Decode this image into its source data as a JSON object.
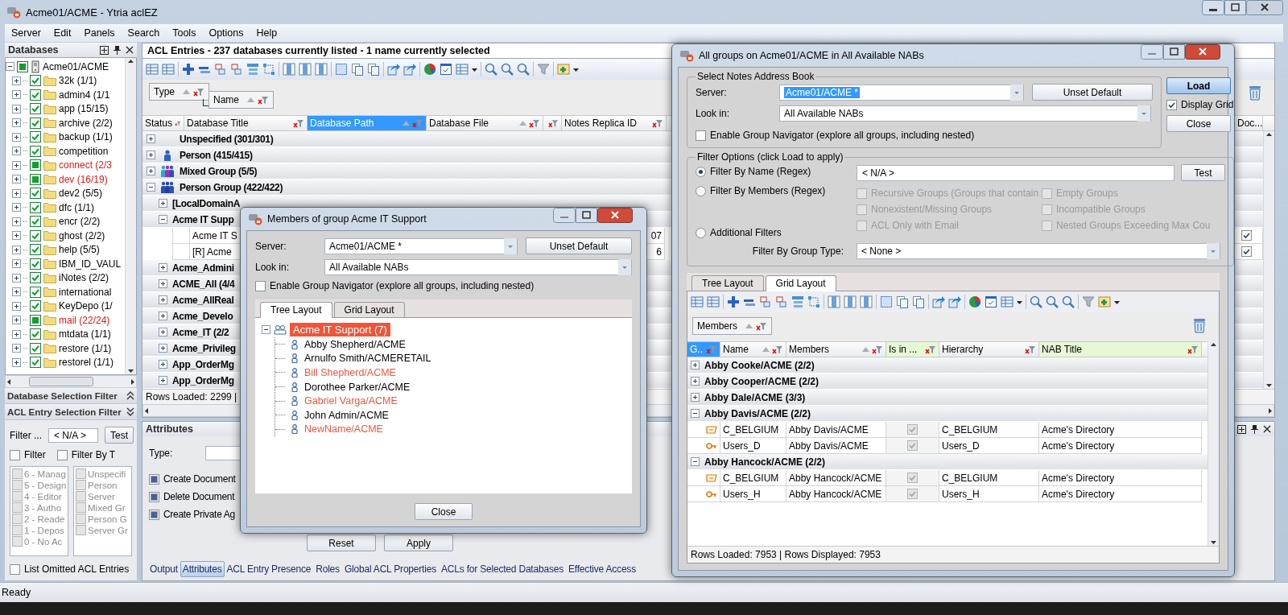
{
  "window": {
    "title": "Acme01/ACME - Ytria aclEZ"
  },
  "menu": [
    "Server",
    "Edit",
    "Panels",
    "Search",
    "Tools",
    "Options",
    "Help"
  ],
  "databases": {
    "title": "Databases",
    "root": {
      "label": "Acme01/ACME",
      "checked": true,
      "partial": true,
      "expanded": true,
      "children": [
        {
          "label": "32k  (1/1)",
          "checked": true,
          "partial": false
        },
        {
          "label": "admin4  (1/1",
          "checked": true,
          "partial": false
        },
        {
          "label": "app  (15/15)",
          "checked": true,
          "partial": false
        },
        {
          "label": "archive  (2/2)",
          "checked": true,
          "partial": false
        },
        {
          "label": "backup  (1/1)",
          "checked": true,
          "partial": false
        },
        {
          "label": "competition",
          "checked": true,
          "partial": false
        },
        {
          "label": "connect  (2/3",
          "checked": true,
          "partial": true
        },
        {
          "label": "dev  (16/19)",
          "checked": true,
          "partial": true
        },
        {
          "label": "dev2  (5/5)",
          "checked": true,
          "partial": false
        },
        {
          "label": "dfc  (1/1)",
          "checked": true,
          "partial": false
        },
        {
          "label": "encr  (2/2)",
          "checked": true,
          "partial": false
        },
        {
          "label": "ghost  (2/2)",
          "checked": true,
          "partial": false
        },
        {
          "label": "help  (5/5)",
          "checked": true,
          "partial": false
        },
        {
          "label": "IBM_ID_VAUL",
          "checked": true,
          "partial": false
        },
        {
          "label": "iNotes  (2/2)",
          "checked": true,
          "partial": false
        },
        {
          "label": "international",
          "checked": true,
          "partial": false
        },
        {
          "label": "KeyDepo  (1/",
          "checked": true,
          "partial": false
        },
        {
          "label": "mail  (22/24)",
          "checked": true,
          "partial": true
        },
        {
          "label": "mtdata  (1/1)",
          "checked": true,
          "partial": false
        },
        {
          "label": "restore  (1/1)",
          "checked": true,
          "partial": false
        },
        {
          "label": "restorel  (1/1)",
          "checked": true,
          "partial": false
        }
      ]
    }
  },
  "database_selection_filter": {
    "title": "Database Selection Filter",
    "expanded": false
  },
  "acl_entry_filter": {
    "title": "ACL Entry Selection Filter",
    "expanded": true,
    "filter_label": "Filter ...",
    "filter_value": "< N/A >",
    "test_button": "Test",
    "options": [
      {
        "label": "Filter",
        "checked": false
      },
      {
        "label": "Filter By T",
        "checked": false
      }
    ],
    "levels": [
      {
        "label": "6 - Manag",
        "checked": false
      },
      {
        "label": "5 - Design",
        "checked": false
      },
      {
        "label": "4 - Editor",
        "checked": false
      },
      {
        "label": "3 - Autho",
        "checked": false
      },
      {
        "label": "2 - Reade",
        "checked": false
      },
      {
        "label": "1 - Depos",
        "checked": false
      },
      {
        "label": "0 - No Ac",
        "checked": false
      }
    ],
    "types": [
      {
        "label": "Unspecifi",
        "checked": false
      },
      {
        "label": "Person",
        "checked": false
      },
      {
        "label": "Server",
        "checked": false
      },
      {
        "label": "Mixed Gr",
        "checked": false
      },
      {
        "label": "Person G",
        "checked": false
      },
      {
        "label": "Server Gr",
        "checked": false
      }
    ],
    "list_omitted": {
      "label": "List Omitted ACL Entries",
      "checked": false
    }
  },
  "acl_entries": {
    "title": "ACL Entries - 237 databases currently listed - 1 name currently selected",
    "group_by": [
      "Type",
      "Name"
    ],
    "columns": [
      {
        "label": "Status",
        "selected": false,
        "sorted": false
      },
      {
        "label": "Database Title",
        "selected": false,
        "sorted": false
      },
      {
        "label": "Database Path",
        "selected": true,
        "sorted": true
      },
      {
        "label": "Database File",
        "selected": false,
        "sorted": true
      },
      {
        "selected": false,
        "sorted": false
      },
      {
        "label": "Notes Replica ID",
        "selected": false,
        "sorted": false
      }
    ],
    "last_column": "Doc...",
    "rows": [
      {
        "kind": "unspecified",
        "label": "Unspecified (301/301)",
        "expanded": false
      },
      {
        "kind": "person",
        "label": "Person (415/415)",
        "expanded": false
      },
      {
        "kind": "mixed",
        "label": "Mixed Group (5/5)",
        "expanded": false
      },
      {
        "kind": "group",
        "label": "Person Group (422/422)",
        "expanded": true,
        "children": [
          {
            "label": "[LocalDomainA",
            "expanded": false
          },
          {
            "label": "Acme IT Supp",
            "expanded": true,
            "entries": [
              {
                "title": "Acme IT S",
                "value": "07",
                "doc_checked": true
              },
              {
                "title": "[R] Acme",
                "value": "6",
                "doc_checked": true
              }
            ]
          },
          {
            "label": "Acme_Admini",
            "expanded": false
          },
          {
            "label": "ACME_All (4/4",
            "expanded": false
          },
          {
            "label": "Acme_AllReal",
            "expanded": false
          },
          {
            "label": "Acme_Develo",
            "expanded": false
          },
          {
            "label": "Acme_IT (2/2",
            "expanded": false
          },
          {
            "label": "Acme_Privileg",
            "expanded": false
          },
          {
            "label": "App_OrderMg",
            "expanded": false
          },
          {
            "label": "App_OrderMg",
            "expanded": false
          }
        ]
      }
    ],
    "status": "Rows Loaded: 2299  |"
  },
  "attributes": {
    "title": "Attributes",
    "type_label": "Type:",
    "permissions": [
      {
        "label": "Create Document",
        "checked": true
      },
      {
        "label": "Delete Document",
        "checked": true
      },
      {
        "label": "Create Private Ag",
        "checked": true
      }
    ],
    "buttons": [
      "Reset",
      "Apply"
    ]
  },
  "bottom_tabs": [
    {
      "label": "Output",
      "selected": false
    },
    {
      "label": "Attributes",
      "selected": true
    },
    {
      "label": "ACL Entry Presence",
      "selected": false
    },
    {
      "label": "Roles",
      "selected": false
    },
    {
      "label": "Global ACL Properties",
      "selected": false
    },
    {
      "label": "ACLs for Selected Databases",
      "selected": false
    },
    {
      "label": "Effective Access",
      "selected": false
    }
  ],
  "status_bar": {
    "text": "Ready"
  },
  "members_dialog": {
    "title": "Members of group Acme IT Support",
    "server_label": "Server:",
    "server": "Acme01/ACME *",
    "server_selected": false,
    "unset_button": "Unset Default",
    "look_in_label": "Look in:",
    "look_in": "All Available NABs",
    "navigator": {
      "label": "Enable Group Navigator (explore all groups, including nested)",
      "checked": false
    },
    "tabs": [
      {
        "label": "Tree Layout",
        "selected": true
      },
      {
        "label": "Grid Layout",
        "selected": false
      }
    ],
    "tree": {
      "label": "Acme IT Support (7)",
      "selected": true,
      "expanded": true,
      "members": [
        {
          "name": "Abby Shepherd/ACME",
          "color": "#000000"
        },
        {
          "name": "Arnulfo Smith/ACMERETAIL",
          "color": "#000000"
        },
        {
          "name": "Bill Shepherd/ACME",
          "color": "#f0553a"
        },
        {
          "name": "Dorothee Parker/ACME",
          "color": "#000000"
        },
        {
          "name": "Gabriel Varga/ACME",
          "color": "#f0553a"
        },
        {
          "name": "John Admin/ACME",
          "color": "#000000"
        },
        {
          "name": "NewName/ACME",
          "color": "#f0553a"
        }
      ]
    },
    "close_button": "Close"
  },
  "groups_dialog": {
    "title": "All groups on Acme01/ACME in All Available NABs",
    "address_book": {
      "legend": "Select Notes Address Book",
      "server_label": "Server:",
      "server": "Acme01/ACME *",
      "server_selected": true,
      "unset_button": "Unset Default",
      "look_in_label": "Look in:",
      "look_in": "All Available NABs",
      "navigator": {
        "label": "Enable Group Navigator (explore all groups, including nested)",
        "checked": false
      }
    },
    "load_button": "Load",
    "display_grid": {
      "label": "Display Grid",
      "checked": true
    },
    "close_button": "Close",
    "filter_options": {
      "legend": "Filter Options (click Load to apply)",
      "modes": [
        {
          "label": "Filter By Name (Regex)",
          "selected": true
        },
        {
          "label": "Filter By Members (Regex)",
          "selected": false
        },
        {
          "label": "Additional Filters",
          "selected": false
        }
      ],
      "regex": "< N/A >",
      "test_button": "Test",
      "additional": [
        {
          "label": "Recursive Groups (Groups that contain",
          "checked": false,
          "disabled": true
        },
        {
          "label": "Empty Groups",
          "checked": false,
          "disabled": true
        },
        {
          "label": "Nonexistent/Missing Groups",
          "checked": false,
          "disabled": true
        },
        {
          "label": "Incompatible Groups",
          "checked": false,
          "disabled": true
        },
        {
          "label": "ACL Only with Email",
          "checked": false,
          "disabled": true
        },
        {
          "label": "Nested Groups Exceeding Max Cou",
          "checked": false,
          "disabled": true
        }
      ],
      "group_type_label": "Filter By Group Type:",
      "group_type": "< None >"
    },
    "tabs": [
      {
        "label": "Tree Layout",
        "selected": false
      },
      {
        "label": "Grid Layout",
        "selected": true
      }
    ],
    "grid": {
      "group_by": [
        "Members"
      ],
      "columns": [
        {
          "label": "G..",
          "selected": true,
          "sorted": false,
          "highlighted": false
        },
        {
          "label": "Name",
          "selected": false,
          "sorted": true,
          "highlighted": false
        },
        {
          "label": "Members",
          "selected": false,
          "sorted": true,
          "highlighted": false
        },
        {
          "label": "Is in ...",
          "selected": false,
          "sorted": false,
          "highlighted": true
        },
        {
          "label": "Hierarchy",
          "selected": false,
          "sorted": false,
          "highlighted": false
        },
        {
          "label": "NAB Title",
          "selected": false,
          "sorted": false,
          "highlighted": true
        }
      ],
      "rows": [
        {
          "label": "Abby Cooke/ACME (2/2)",
          "expanded": false
        },
        {
          "label": "Abby Cooper/ACME (2/2)",
          "expanded": false
        },
        {
          "label": "Abby Dale/ACME (3/3)",
          "expanded": false
        },
        {
          "label": "Abby Davis/ACME (2/2)",
          "expanded": true,
          "entries": [
            {
              "kind": "tag",
              "name": "C_BELGIUM",
              "members": "Abby Davis/ACME",
              "is_in": true,
              "hierarchy": "C_BELGIUM",
              "nab_title": "Acme's Directory"
            },
            {
              "kind": "key",
              "name": "Users_D",
              "members": "Abby Davis/ACME",
              "is_in": true,
              "hierarchy": "Users_D",
              "nab_title": "Acme's Directory"
            }
          ]
        },
        {
          "label": "Abby Hancock/ACME (2/2)",
          "expanded": true,
          "entries": [
            {
              "kind": "tag",
              "name": "C_BELGIUM",
              "members": "Abby Hancock/ACME",
              "is_in": true,
              "hierarchy": "C_BELGIUM",
              "nab_title": "Acme's Directory"
            },
            {
              "kind": "key",
              "name": "Users_H",
              "members": "Abby Hancock/ACME",
              "is_in": true,
              "hierarchy": "Users_H",
              "nab_title": "Acme's Directory"
            }
          ]
        }
      ],
      "status": "Rows Loaded: 7953  |  Rows Displayed: 7953"
    }
  }
}
